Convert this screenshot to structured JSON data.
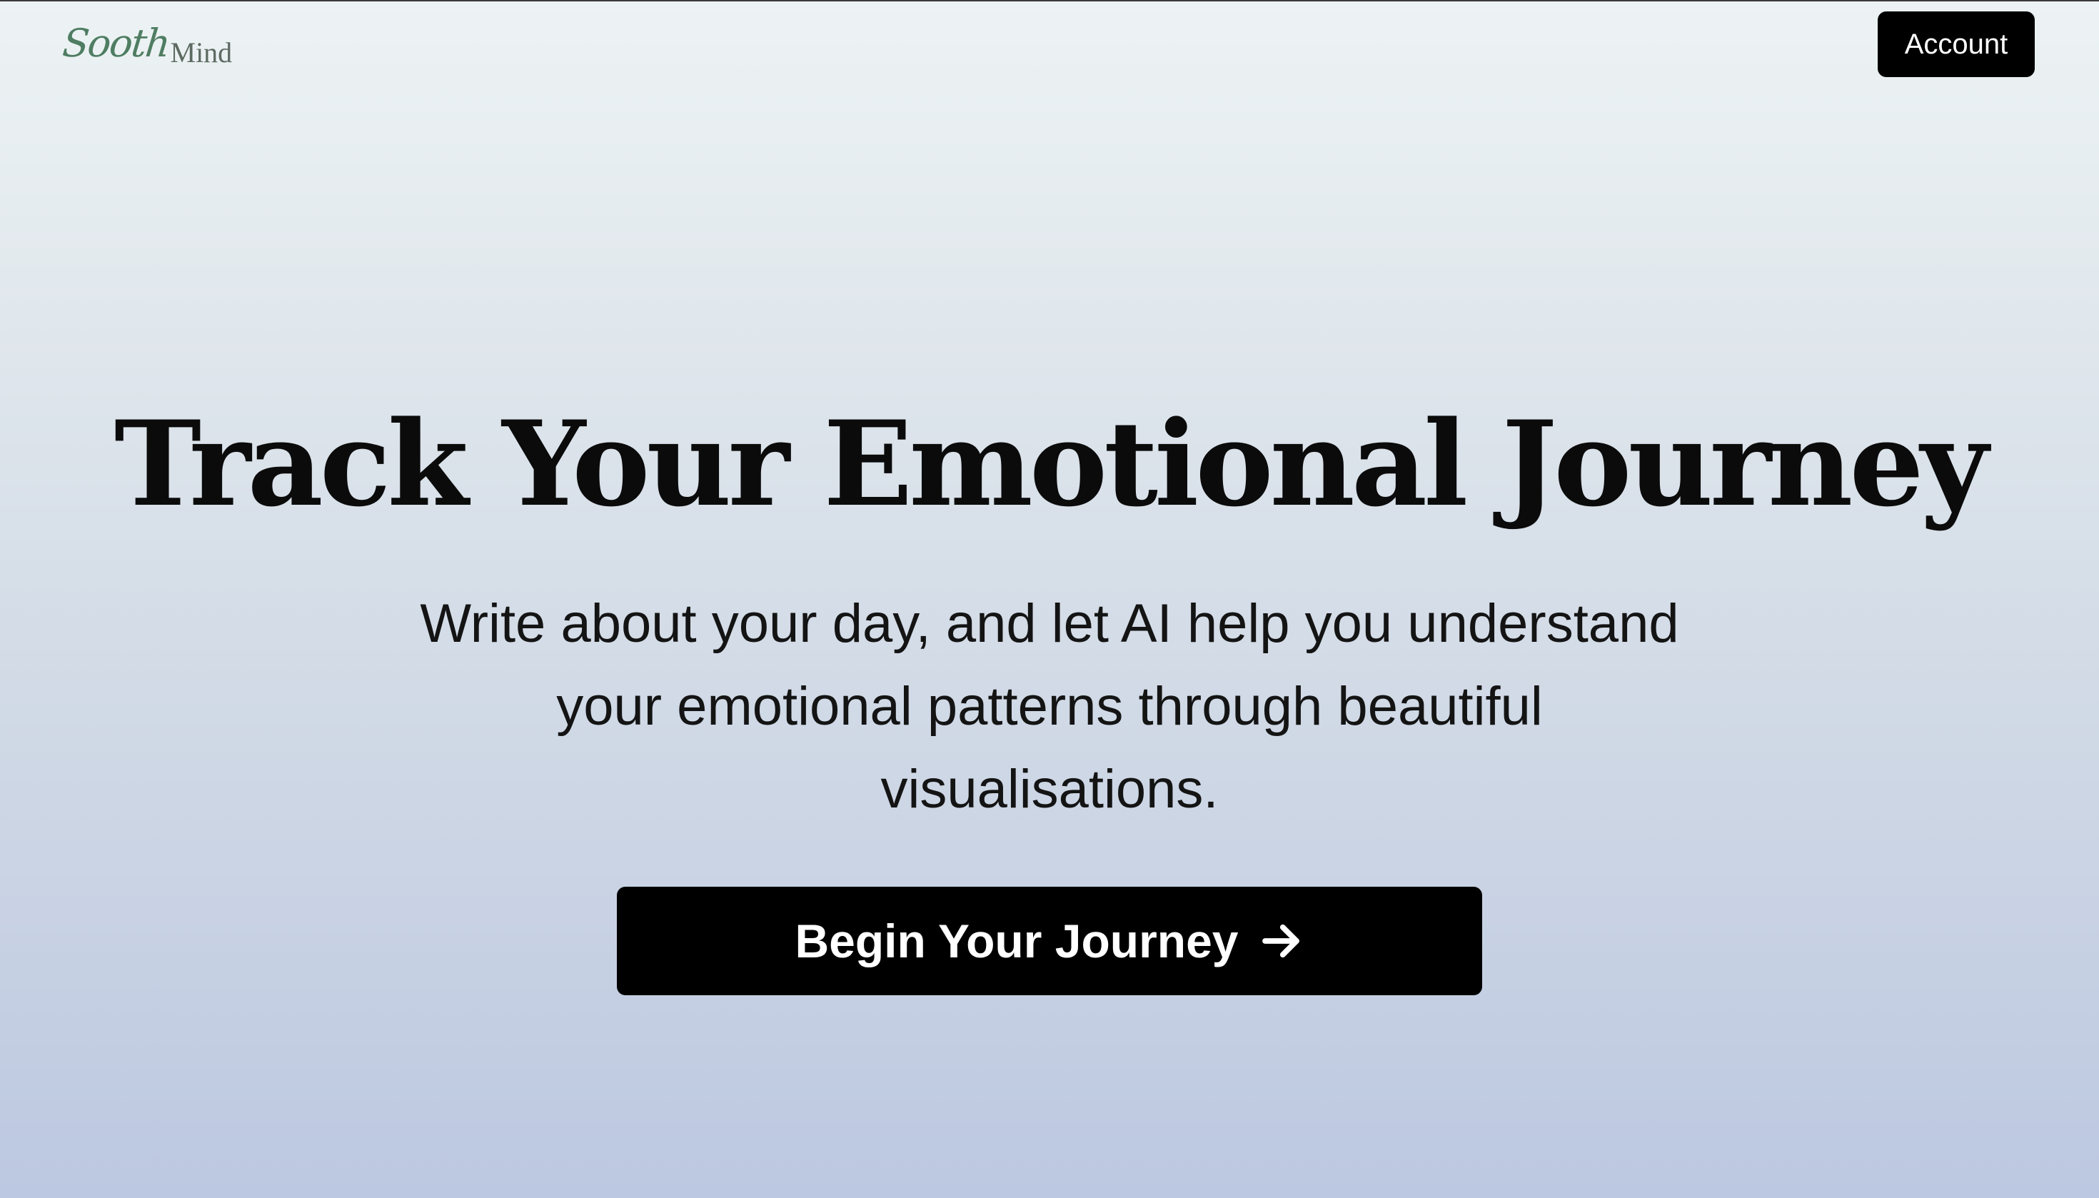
{
  "header": {
    "logo": {
      "part1": "Sooth",
      "part2": "Mind"
    },
    "account_label": "Account"
  },
  "hero": {
    "title": "Track Your Emotional Journey",
    "subtitle": "Write about your day, and let AI help you understand your emotional patterns through beautiful visualisations.",
    "cta_label": "Begin Your Journey",
    "cta_icon": "arrow-right-icon"
  },
  "colors": {
    "background_top": "#edf3f4",
    "background_bottom": "#bcc8e1",
    "logo_accent": "#4f7d62",
    "button_bg": "#000000",
    "button_text": "#ffffff"
  }
}
